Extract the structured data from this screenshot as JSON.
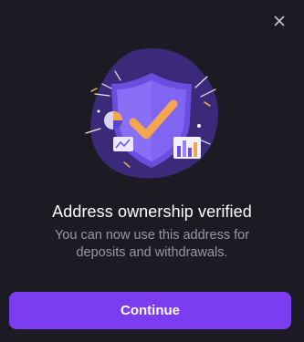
{
  "modal": {
    "close_icon": "close-icon",
    "illustration": "verified-shield-illustration",
    "title": "Address ownership verified",
    "subtitle": "You can now use this address for deposits and withdrawals.",
    "continue_label": "Continue"
  },
  "colors": {
    "background": "#1c1a22",
    "accent": "#7c3cf0",
    "title_text": "#ffffff",
    "subtitle_text": "#9a97a6",
    "checkmark": "#f2a650"
  }
}
